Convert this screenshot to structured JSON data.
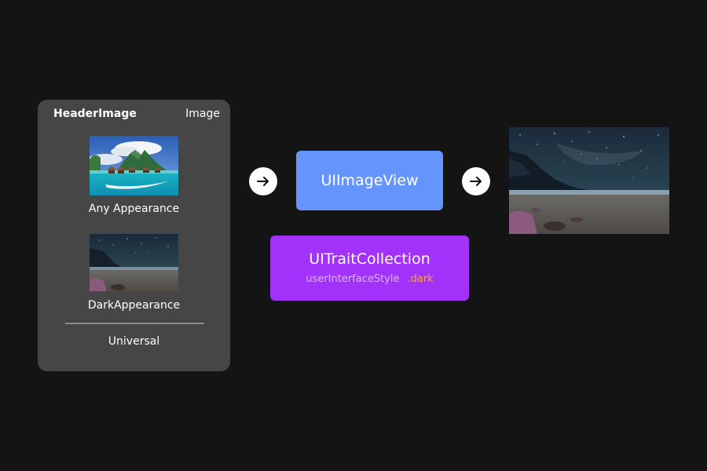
{
  "panel": {
    "title": "HeaderImage",
    "type_label": "Image",
    "variants": [
      {
        "label": "Any Appearance",
        "scene": "tropical-bungalows-day"
      },
      {
        "label": "DarkAppearance",
        "scene": "night-beach-starry-sky"
      }
    ],
    "footer_label": "Universal"
  },
  "flow": {
    "image_view_label": "UIImageView",
    "trait_collection": {
      "title": "UITraitCollection",
      "property": "userInterfaceStyle",
      "value": ".dark"
    },
    "result_scene": "night-beach-starry-sky"
  },
  "icons": {
    "arrow": "arrow-right-icon"
  },
  "colors": {
    "background": "#141414",
    "panel": "#464646",
    "image_view": "#6495fc",
    "trait_collection": "#a231f9",
    "trait_property": "#dab4fb",
    "trait_value": "#f4a146"
  }
}
